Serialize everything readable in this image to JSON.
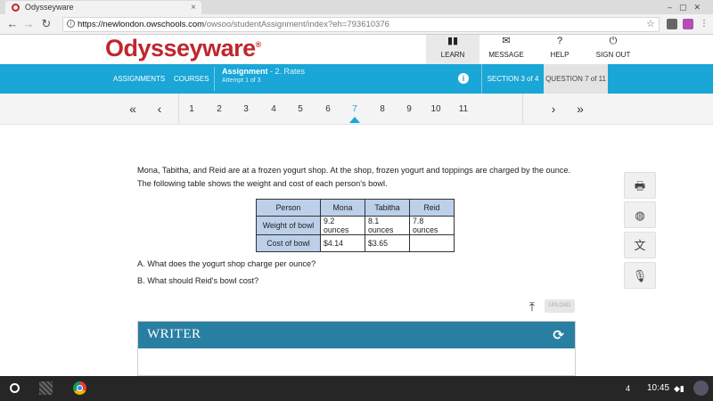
{
  "browser": {
    "tab_title": "Odysseyware",
    "tab_close": "×",
    "window_controls": "–▢✕",
    "url_host": "https://newlondon.owschools.com",
    "url_path": "/owsoo/studentAssignment/index?eh=793610376",
    "back_icon": "←",
    "forward_icon": "→",
    "reload_icon": "↻",
    "info_icon": "i",
    "star_icon": "☆"
  },
  "site": {
    "logo": "Odysseyware",
    "logo_mark": "®",
    "nav": [
      {
        "label": "LEARN",
        "icon": "▮▮"
      },
      {
        "label": "MESSAGE",
        "icon": "✉"
      },
      {
        "label": "HELP",
        "icon": "?"
      },
      {
        "label": "SIGN OUT",
        "icon": "⏻"
      }
    ]
  },
  "bluebar": {
    "assignments": "ASSIGNMENTS",
    "courses": "COURSES",
    "assignment_label": "Assignment",
    "assignment_name": "- 2. Rates",
    "attempt": "Attempt 1 of 3",
    "info_icon": "i",
    "section": "SECTION 3 of 4",
    "question": "QUESTION 7 of 11"
  },
  "pager": {
    "first": "«",
    "prev": "‹",
    "next": "›",
    "last": "»",
    "pages": [
      "1",
      "2",
      "3",
      "4",
      "5",
      "6",
      "7",
      "8",
      "9",
      "10",
      "11"
    ],
    "current_index": 6
  },
  "question": {
    "prompt": "Mona, Tabitha, and Reid are at a frozen yogurt shop. At the shop, frozen yogurt and toppings are charged by the ounce. The following table shows the weight and cost of each person's bowl.",
    "table": {
      "headers": [
        "Person",
        "Mona",
        "Tabitha",
        "Reid"
      ],
      "rows": [
        [
          "Weight of bowl",
          "9.2 ounces",
          "8.1 ounces",
          "7.8 ounces"
        ],
        [
          "Cost of bowl",
          "$4.14",
          "$3.65",
          ""
        ]
      ]
    },
    "part_a": "A. What does the yogurt shop charge per ounce?",
    "part_b": "B. What should Reid's bowl cost?"
  },
  "tools": {
    "print_icon": "🖶",
    "globe_icon": "◍",
    "translate_icon": "文",
    "mic_icon": "🎙"
  },
  "upload": {
    "icon": "⤒",
    "label": "UPLOAD"
  },
  "writer": {
    "title": "WRITER",
    "refresh_icon": "⟳"
  },
  "taskbar": {
    "notification_count": "4",
    "time": "10:45",
    "status_icons": "◆▮"
  }
}
